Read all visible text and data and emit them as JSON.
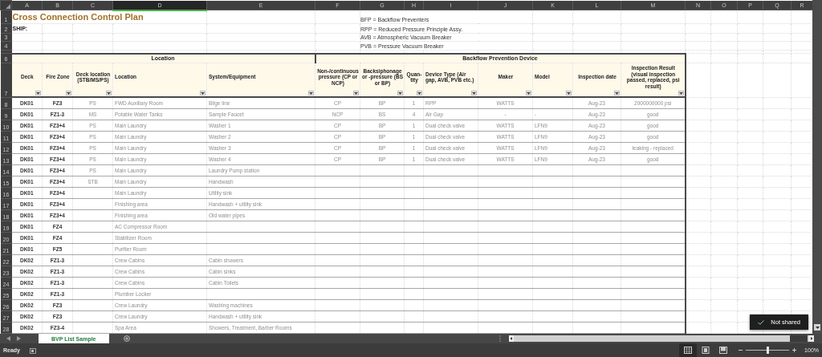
{
  "column_headers": [
    {
      "label": "A",
      "selected": false
    },
    {
      "label": "B",
      "selected": false
    },
    {
      "label": "C",
      "selected": false
    },
    {
      "label": "D",
      "selected": true
    },
    {
      "label": "E",
      "selected": false
    },
    {
      "label": "F",
      "selected": false
    },
    {
      "label": "G",
      "selected": false
    },
    {
      "label": "H",
      "selected": false
    },
    {
      "label": "I",
      "selected": false
    },
    {
      "label": "J",
      "selected": false
    },
    {
      "label": "K",
      "selected": false
    },
    {
      "label": "L",
      "selected": false
    },
    {
      "label": "M",
      "selected": false
    },
    {
      "label": "N",
      "selected": false
    },
    {
      "label": "O",
      "selected": false
    },
    {
      "label": "P",
      "selected": false
    },
    {
      "label": "Q",
      "selected": false
    },
    {
      "label": "R",
      "selected": false
    }
  ],
  "top_rows": [
    {
      "number": "1",
      "title": "Cross Connection Control Plan",
      "legend": "BFP = Backflow Preventers"
    },
    {
      "number": "2",
      "ship_label": "SHIP:",
      "legend": "RPP = Reduced Pressure Principle Assy."
    },
    {
      "number": "3",
      "legend": "AVB = Atmospheric Vacuum Breaker"
    },
    {
      "number": "4",
      "legend": "PVB = Pressure Vacuum Breaker"
    },
    {
      "number": null
    }
  ],
  "group_header_row": {
    "number": "6",
    "groups": [
      "Location",
      "Backflow Prevention Device"
    ]
  },
  "column_header_row": {
    "number": "7",
    "columns": [
      "Deck",
      "Fire Zone",
      "Deck location (STB/MS/PS)",
      "Location",
      "System/Equipment",
      "Non-/continuous pressure (CP or NCP)",
      "Backsiphonage or -pressure (BS or BP)",
      "Quan-tity",
      "Device Type (Air gap, AVB, PVB etc.)",
      "Maker",
      "Model",
      "Inspection date",
      "Inspection Result (visual inspection passed, replaced, psi result)"
    ]
  },
  "rows": [
    {
      "number": "8",
      "cells": [
        "DK01",
        "FZ3",
        "PS",
        "FWD Auxiliary Room",
        "Bilge line",
        "CP",
        "BP",
        "1",
        "RPP",
        "WATTS",
        null,
        "Aug-23",
        "2000000000 psi"
      ]
    },
    {
      "number": "9",
      "cells": [
        "DK01",
        "FZ1-3",
        "MS",
        "Potable Water Tanks",
        "Sample Faucet",
        "NCP",
        "BS",
        "4",
        "Air Gap",
        "-",
        "-",
        "Aug-23",
        "good"
      ]
    },
    {
      "number": "10",
      "cells": [
        "DK01",
        "FZ3+4",
        "PS",
        "Main Laundry",
        "Washer 1",
        "CP",
        "BP",
        "1",
        "Dual check valve",
        "WATTS",
        "LFN9",
        "Aug-23",
        "good"
      ]
    },
    {
      "number": "11",
      "cells": [
        "DK01",
        "FZ3+4",
        "PS",
        "Main Laundry",
        "Washer 2",
        "CP",
        "BP",
        "1",
        "Dual check valve",
        "WATTS",
        "LFN9",
        "Aug-23",
        "good"
      ]
    },
    {
      "number": "12",
      "cells": [
        "DK01",
        "FZ3+4",
        "PS",
        "Main Laundry",
        "Washer 3",
        "CP",
        "BP",
        "1",
        "Dual check valve",
        "WATTS",
        "LFN9",
        "Aug-23",
        "leaking - replaced"
      ]
    },
    {
      "number": "13",
      "cells": [
        "DK01",
        "FZ3+4",
        "PS",
        "Main Laundry",
        "Washer 4",
        "CP",
        "BP",
        "1",
        "Dual check valve",
        "WATTS",
        "LFN9",
        "Aug-23",
        "good"
      ]
    },
    {
      "number": "14",
      "cells": [
        "DK01",
        "FZ3+4",
        "PS",
        "Main Laundry",
        "Laundry Pump station"
      ]
    },
    {
      "number": "15",
      "cells": [
        "DK01",
        "FZ3+4",
        "STB",
        "Main Laundry",
        "Handwash"
      ]
    },
    {
      "number": "16",
      "cells": [
        "DK01",
        "FZ3+4",
        null,
        "Main Laundry",
        "Utility sink"
      ]
    },
    {
      "number": "17",
      "cells": [
        "DK01",
        "FZ3+4",
        null,
        "Finishing area",
        "Handwash + utility sink"
      ]
    },
    {
      "number": "18",
      "cells": [
        "DK01",
        "FZ3+4",
        null,
        "Finishing area",
        "Old water pipes"
      ]
    },
    {
      "number": "19",
      "cells": [
        "DK01",
        "FZ4",
        null,
        "AC Compressor Room"
      ]
    },
    {
      "number": "20",
      "cells": [
        "DK01",
        "FZ4",
        null,
        "Stabilizer Room"
      ]
    },
    {
      "number": "21",
      "cells": [
        "DK01",
        "FZ5",
        null,
        "Purifier Room"
      ]
    },
    {
      "number": "22",
      "cells": [
        "DK02",
        "FZ1-3",
        null,
        "Crew Cabins",
        "Cabin showers"
      ]
    },
    {
      "number": "23",
      "cells": [
        "DK02",
        "FZ1-3",
        null,
        "Crew Cabins",
        "Cabin sinks"
      ]
    },
    {
      "number": "24",
      "cells": [
        "DK02",
        "FZ1-3",
        null,
        "Crew Cabins",
        "Cabin Toilets"
      ]
    },
    {
      "number": "25",
      "cells": [
        "DK02",
        "FZ1-3",
        null,
        "Plumber Locker"
      ]
    },
    {
      "number": "26",
      "cells": [
        "DK02",
        "FZ3",
        null,
        "Crew Laundry",
        "Washing machines"
      ]
    },
    {
      "number": "27",
      "cells": [
        "DK02",
        "FZ3",
        null,
        "Crew Laundry",
        "Handwash + utility sink"
      ]
    },
    {
      "number": "28",
      "cells": [
        "DK02",
        "FZ3-4",
        null,
        "Spa Area",
        "Showers, Treatment, Barber Rooms"
      ]
    }
  ],
  "sheet_tabs": [
    {
      "label": "BVP List Sample",
      "selected": true
    }
  ],
  "toast": {
    "text": "Not shared"
  },
  "status_bar": {
    "text": "Ready",
    "views": [
      {
        "selected": true
      },
      {
        "selected": false
      },
      {
        "selected": false
      }
    ],
    "zoom": {
      "level": 0.5,
      "reading": "100%"
    }
  }
}
